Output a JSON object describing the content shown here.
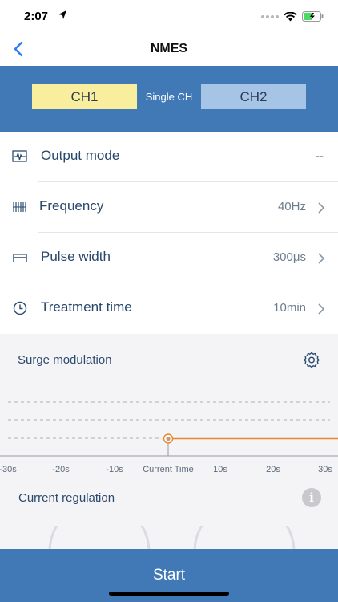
{
  "status": {
    "time": "2:07"
  },
  "nav": {
    "title": "NMES"
  },
  "channels": {
    "ch1": "CH1",
    "mode": "Single CH",
    "ch2": "CH2"
  },
  "settings": [
    {
      "label": "Output mode",
      "value": "--"
    },
    {
      "label": "Frequency",
      "value": "40Hz"
    },
    {
      "label": "Pulse width",
      "value": "300μs"
    },
    {
      "label": "Treatment time",
      "value": "10min"
    }
  ],
  "surge": {
    "label": "Surge modulation",
    "ticks": [
      "-30s",
      "-20s",
      "-10s",
      "Current Time",
      "10s",
      "20s",
      "30s"
    ]
  },
  "current": {
    "label": "Current regulation",
    "info_glyph": "i"
  },
  "start_label": "Start",
  "colors": {
    "primary": "#4179b7",
    "ch1_active": "#f8ee9d",
    "ch2": "#a6c4e6",
    "surge_line": "#e8872e"
  }
}
